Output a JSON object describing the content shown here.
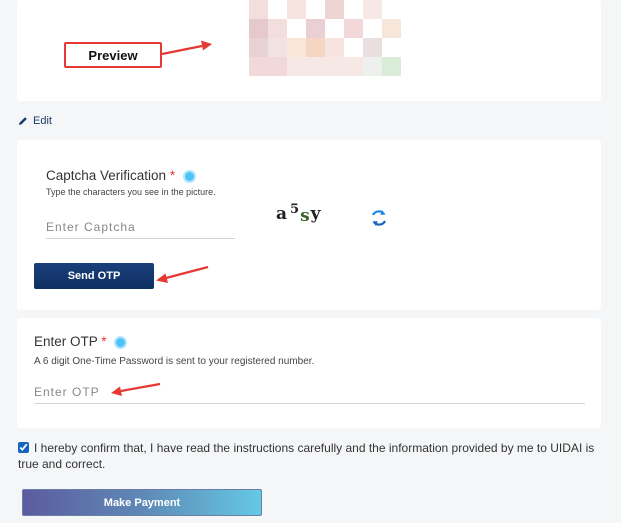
{
  "preview": {
    "callout_label": "Preview",
    "image_colors": [
      "#efd4d4",
      "#f3dede",
      "#e6c9cf",
      "#f7e3e0",
      "#ead0d4",
      "#f2d8d8",
      "#f6e8e5",
      "#fae6d9",
      "#f4d6c2",
      "#f7e7da",
      "#e9d2d6",
      "#f3e2e2",
      "#eadfe0",
      "#d9ecd7"
    ]
  },
  "edit": {
    "label": "Edit",
    "icon": "pencil-icon"
  },
  "captcha": {
    "title": "Captcha Verification",
    "required_mark": "*",
    "hint": "Type the characters you see in the picture.",
    "input_placeholder": "Enter Captcha",
    "image_chars": [
      "a",
      "5",
      "s",
      "y"
    ],
    "refresh_icon": "refresh-icon",
    "send_otp_label": "Send OTP"
  },
  "otp": {
    "title": "Enter OTP",
    "required_mark": "*",
    "hint": "A 6 digit One-Time Password is sent to your registered number.",
    "input_placeholder": "Enter OTP"
  },
  "confirm": {
    "checked": true,
    "text": "I hereby confirm that, I have read the instructions carefully and the information provided by me to UIDAI is true and correct."
  },
  "payment": {
    "button_label": "Make Payment"
  },
  "colors": {
    "annotation_red": "#e53935",
    "primary_navy": "#0f2f63",
    "info_blue": "#4fc3f7"
  }
}
